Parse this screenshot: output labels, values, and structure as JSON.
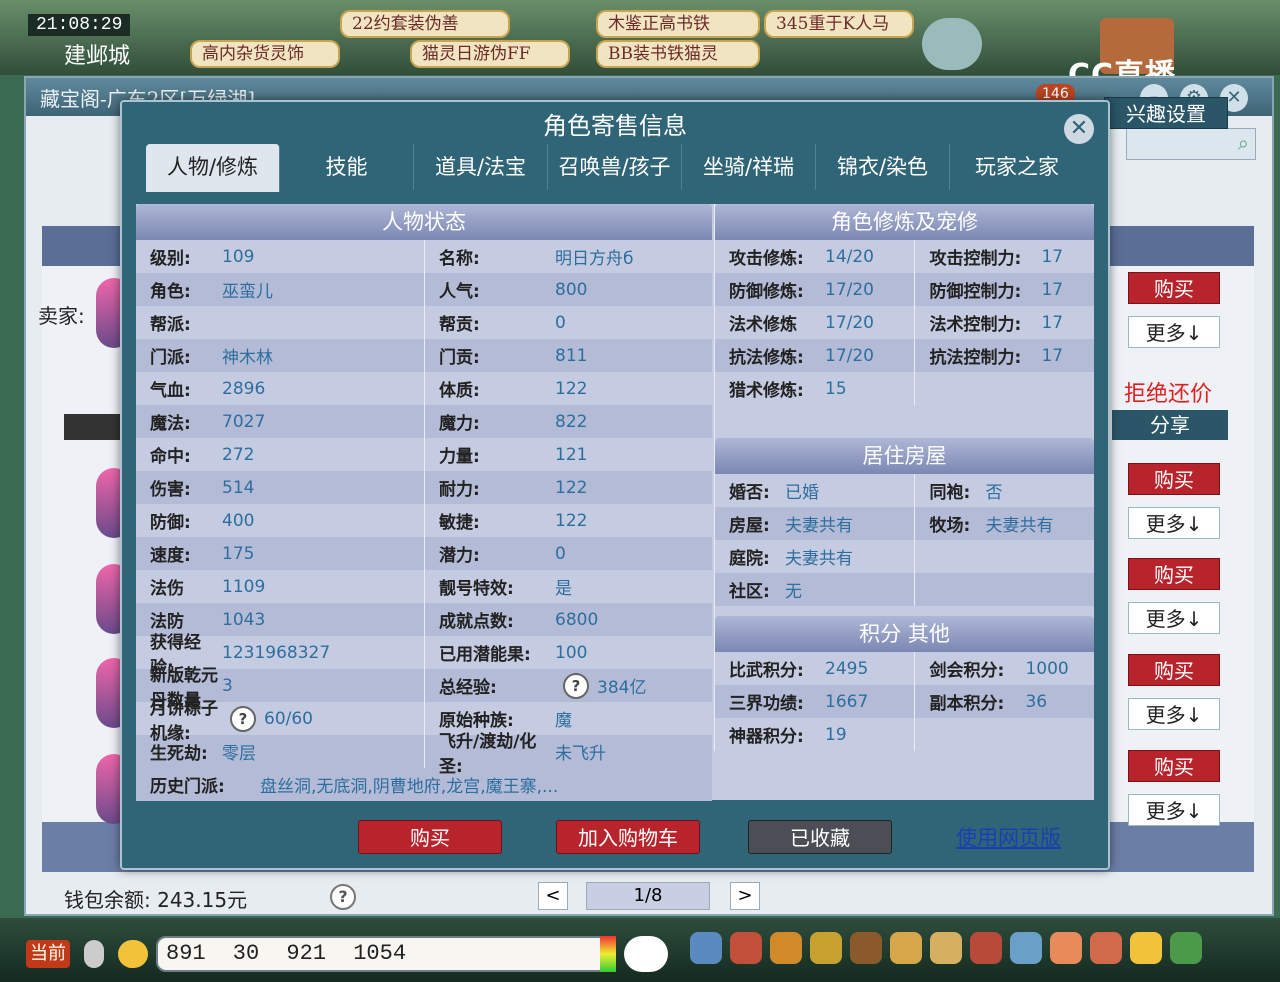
{
  "game": {
    "time": "21:08:29",
    "city": "建邺城",
    "top_buttons": [
      "22约套装伪善",
      "木鉴正高书铁",
      "345重于K人马",
      "高内杂货灵饰",
      "猫灵日游伪FF",
      "BB装书铁猫灵"
    ],
    "stream_logo": "CC直播",
    "current_label": "当前",
    "coords": "891 30  921    1054"
  },
  "back_window": {
    "title": "藏宝阁-广东2区[万绿湖]",
    "badge": "146",
    "interest_button": "兴趣设置",
    "seller_label": "卖家:",
    "no_counter_offer": "拒绝还价",
    "share_button": "分享",
    "buy_label": "购买",
    "more_label": "更多↓",
    "wallet": "钱包余额: 243.15元",
    "pager": "1/8",
    "prev": "<",
    "next": ">",
    "help": "?"
  },
  "modal": {
    "title": "角色寄售信息",
    "close": "✕",
    "tabs": [
      "人物/修炼",
      "技能",
      "道具/法宝",
      "召唤兽/孩子",
      "坐骑/祥瑞",
      "锦衣/染色",
      "玩家之家"
    ],
    "status": {
      "title": "人物状态",
      "rows": [
        [
          {
            "l": "级别:",
            "v": "109"
          },
          {
            "l": "名称:",
            "v": "明日方舟б"
          }
        ],
        [
          {
            "l": "角色:",
            "v": "巫蛮儿"
          },
          {
            "l": "人气:",
            "v": "800"
          }
        ],
        [
          {
            "l": "帮派:",
            "v": ""
          },
          {
            "l": "帮贡:",
            "v": "0"
          }
        ],
        [
          {
            "l": "门派:",
            "v": "神木林"
          },
          {
            "l": "门贡:",
            "v": "811"
          }
        ],
        [
          {
            "l": "气血:",
            "v": "2896"
          },
          {
            "l": "体质:",
            "v": "122"
          }
        ],
        [
          {
            "l": "魔法:",
            "v": "7027"
          },
          {
            "l": "魔力:",
            "v": "822"
          }
        ],
        [
          {
            "l": "命中:",
            "v": "272"
          },
          {
            "l": "力量:",
            "v": "121"
          }
        ],
        [
          {
            "l": "伤害:",
            "v": "514"
          },
          {
            "l": "耐力:",
            "v": "122"
          }
        ],
        [
          {
            "l": "防御:",
            "v": "400"
          },
          {
            "l": "敏捷:",
            "v": "122"
          }
        ],
        [
          {
            "l": "速度:",
            "v": "175"
          },
          {
            "l": "潜力:",
            "v": "0"
          }
        ],
        [
          {
            "l": "法伤",
            "v": "1109"
          },
          {
            "l": "靓号特效:",
            "v": "是"
          }
        ],
        [
          {
            "l": "法防",
            "v": "1043"
          },
          {
            "l": "成就点数:",
            "v": "6800"
          }
        ],
        [
          {
            "l": "获得经验:",
            "v": "1231968327"
          },
          {
            "l": "已用潜能果:",
            "v": "100"
          }
        ],
        [
          {
            "l": "新版乾元丹数量",
            "v": "3"
          },
          {
            "l": "总经验:",
            "v": "384亿"
          }
        ],
        [
          {
            "l": "月饼粽子机缘:",
            "v": "60/60"
          },
          {
            "l": "原始种族:",
            "v": "魔"
          }
        ],
        [
          {
            "l": "生死劫:",
            "v": "零层"
          },
          {
            "l": "飞升/渡劫/化圣:",
            "v": "未飞升"
          }
        ]
      ],
      "history_label": "历史门派:",
      "history_value": "盘丝洞,无底洞,阴曹地府,龙宫,魔王寨,..."
    },
    "cultivation": {
      "title": "角色修炼及宠修",
      "rows": [
        [
          {
            "l": "攻击修炼:",
            "v": "14/20"
          },
          {
            "l": "攻击控制力:",
            "v": "17"
          }
        ],
        [
          {
            "l": "防御修炼:",
            "v": "17/20"
          },
          {
            "l": "防御控制力:",
            "v": "17"
          }
        ],
        [
          {
            "l": "法术修炼",
            "v": "17/20"
          },
          {
            "l": "法术控制力:",
            "v": "17"
          }
        ],
        [
          {
            "l": "抗法修炼:",
            "v": "17/20"
          },
          {
            "l": "抗法控制力:",
            "v": "17"
          }
        ],
        [
          {
            "l": "猎术修炼:",
            "v": "15"
          },
          {
            "l": "",
            "v": ""
          }
        ]
      ]
    },
    "housing": {
      "title": "居住房屋",
      "rows": [
        [
          {
            "l": "婚否:",
            "v": "已婚"
          },
          {
            "l": "同袍:",
            "v": "否"
          }
        ],
        [
          {
            "l": "房屋:",
            "v": "夫妻共有"
          },
          {
            "l": "牧场:",
            "v": "夫妻共有"
          }
        ],
        [
          {
            "l": "庭院:",
            "v": "夫妻共有"
          },
          {
            "l": "",
            "v": ""
          }
        ],
        [
          {
            "l": "社区:",
            "v": "无"
          },
          {
            "l": "",
            "v": ""
          }
        ]
      ]
    },
    "points": {
      "title": "积分 其他",
      "rows": [
        [
          {
            "l": "比武积分:",
            "v": "2495"
          },
          {
            "l": "剑会积分:",
            "v": "1000"
          }
        ],
        [
          {
            "l": "三界功绩:",
            "v": "1667"
          },
          {
            "l": "副本积分:",
            "v": "36"
          }
        ],
        [
          {
            "l": "神器积分:",
            "v": "19"
          },
          {
            "l": "",
            "v": ""
          }
        ]
      ]
    },
    "buttons": {
      "buy": "购买",
      "add_cart": "加入购物车",
      "favorited": "已收藏",
      "web_version": "使用网页版"
    }
  }
}
